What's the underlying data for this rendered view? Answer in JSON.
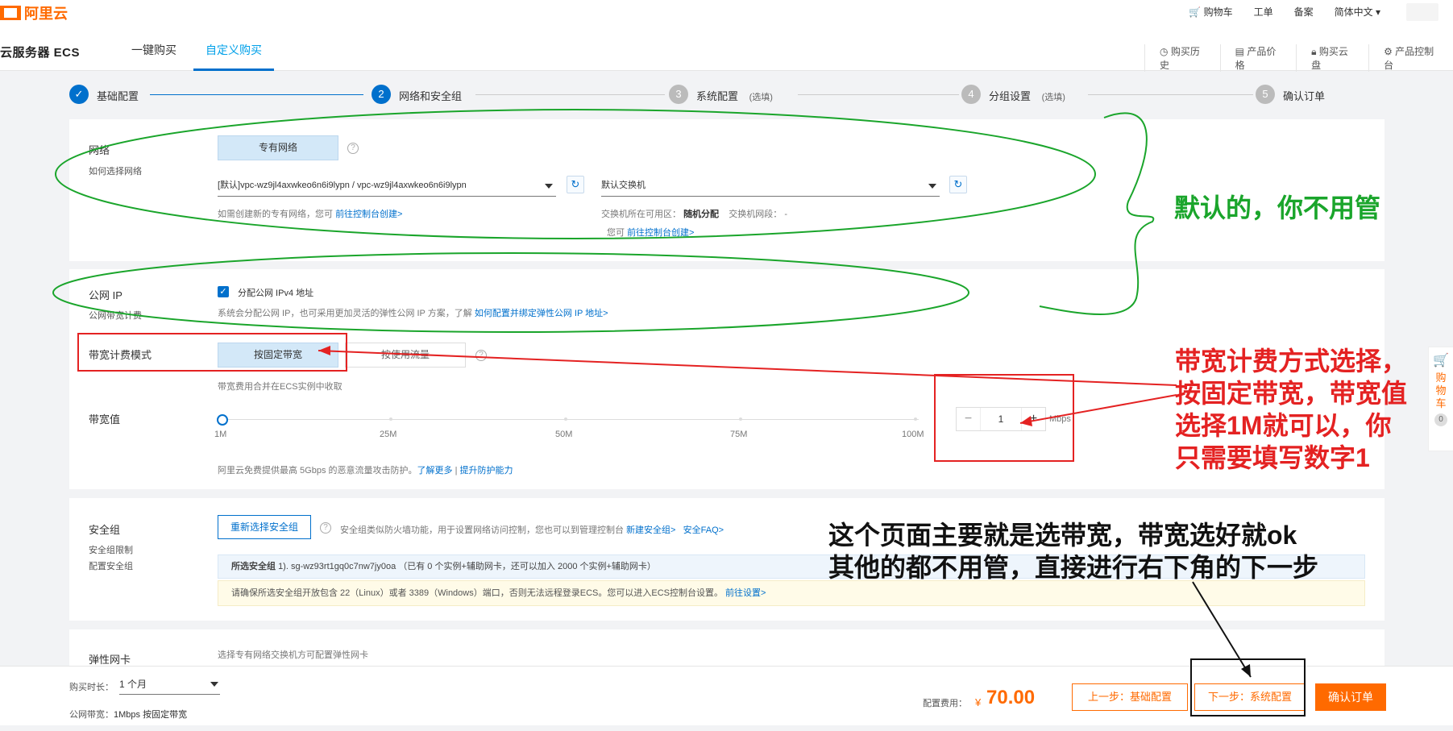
{
  "header": {
    "logo_text": "阿里云",
    "links": [
      "购物车",
      "工单",
      "备案",
      "简体中文"
    ]
  },
  "subheader": {
    "product_title": "云服务器 ECS",
    "tabs": [
      "一键购买",
      "自定义购买"
    ],
    "active_tab": "自定义购买",
    "tools": [
      "购买历史",
      "产品价格",
      "购买云盘",
      "产品控制台"
    ]
  },
  "steps": [
    {
      "num": "✓",
      "label": "基础配置",
      "note": ""
    },
    {
      "num": "2",
      "label": "网络和安全组",
      "note": ""
    },
    {
      "num": "3",
      "label": "系统配置",
      "note": "(选填)"
    },
    {
      "num": "4",
      "label": "分组设置",
      "note": "(选填)"
    },
    {
      "num": "5",
      "label": "确认订单",
      "note": ""
    }
  ],
  "network": {
    "label": "网络",
    "sublabel": "如何选择网络",
    "vpc_button": "专有网络",
    "vpc_select": "[默认]vpc-wz9jl4axwkeo6n6i9lypn / vpc-wz9jl4axwkeo6n6i9lypn",
    "switch_select": "默认交换机",
    "vpc_hint_prefix": "如需创建新的专有网络，您可",
    "vpc_hint_link": "前往控制台创建>",
    "zone_label": "交换机所在可用区：",
    "zone_value": "随机分配",
    "cidr_label": "交换机网段：",
    "cidr_value": "-",
    "switch_hint_prefix": "您可",
    "switch_hint_link": "前往控制台创建>"
  },
  "public_ip": {
    "label": "公网 IP",
    "sublabel": "公网带宽计费",
    "checkbox_label": "分配公网 IPv4 地址",
    "hint_prefix": "系统会分配公网 IP，也可采用更加灵活的弹性公网 IP 方案，了解",
    "hint_link": "如何配置并绑定弹性公网 IP 地址>"
  },
  "billing": {
    "label": "带宽计费模式",
    "option_fixed": "按固定带宽",
    "option_traffic": "按使用流量",
    "hint": "带宽费用合并在ECS实例中收取"
  },
  "bandwidth": {
    "label": "带宽值",
    "ticks": [
      "1M",
      "25M",
      "50M",
      "75M",
      "100M"
    ],
    "value": "1",
    "unit": "Mbps",
    "minus": "−",
    "plus": "+",
    "hint_prefix": "阿里云免费提供最高 5Gbps 的恶意流量攻击防护。",
    "hint_link1": "了解更多",
    "hint_sep": " | ",
    "hint_link2": "提升防护能力"
  },
  "security_group": {
    "label": "安全组",
    "sublabel1": "安全组限制",
    "sublabel2": "配置安全组",
    "button": "重新选择安全组",
    "hint_prefix": "安全组类似防火墙功能，用于设置网络访问控制，您也可以到管理控制台",
    "hint_link1": "新建安全组>",
    "hint_link2": "安全FAQ>",
    "selected_label": "所选安全组",
    "selected_value": "1). sg-wz93rt1gq0c7nw7jy0oa （已有 0 个实例+辅助网卡，还可以加入 2000 个实例+辅助网卡）",
    "warning_text": "请确保所选安全组开放包含 22（Linux）或者 3389（Windows）端口，否则无法远程登录ECS。您可以进入ECS控制台设置。",
    "warning_link": "前往设置>"
  },
  "eni": {
    "label": "弹性网卡",
    "hint": "选择专有网络交换机方可配置弹性网卡"
  },
  "cart_side": {
    "text": "购物车",
    "count": "0"
  },
  "bottom": {
    "duration_label": "购买时长：",
    "duration_value": "1 个月",
    "bw_label": "公网带宽：",
    "bw_value": "1Mbps 按固定带宽",
    "fee_label": "配置费用：",
    "currency": "¥",
    "price": "70.00",
    "prev_button": "上一步：基础配置",
    "next_button": "下一步：系统配置",
    "confirm_button": "确认订单"
  },
  "annotations": {
    "green": "默认的，你不用管",
    "red_lines": [
      "带宽计费方式选择，",
      "按固定带宽，带宽值",
      "选择1M就可以，你",
      "只需要填写数字1"
    ],
    "black_lines": [
      "这个页面主要就是选带宽，带宽选好就ok",
      "其他的都不用管，直接进行右下角的下一步"
    ]
  },
  "colors": {
    "accent": "#ff6a00",
    "primary_blue": "#0070cc",
    "annotation_green": "#1aa52b",
    "annotation_red": "#e42222"
  }
}
